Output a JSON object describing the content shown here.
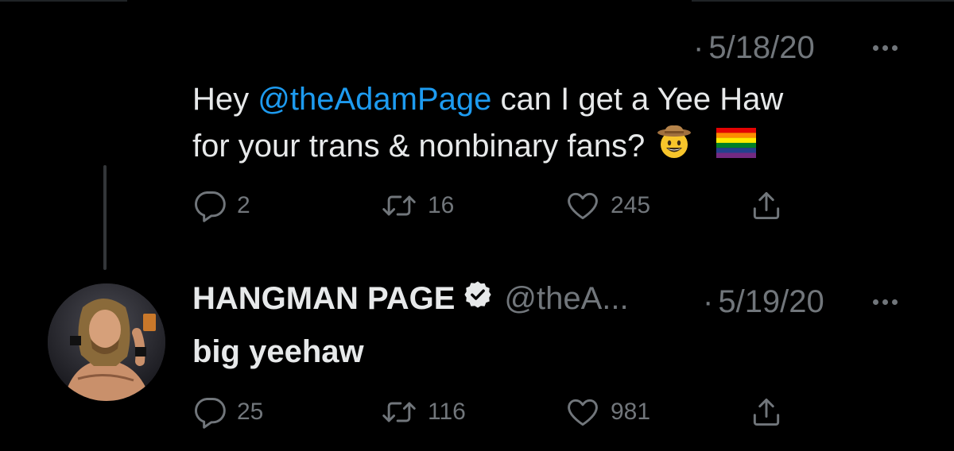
{
  "tweet1": {
    "timestamp": "5/18/20",
    "text_before": "Hey ",
    "mention": "@theAdamPage",
    "text_after_line1": " can I get a Yee Haw",
    "text_line2": "for your trans & nonbinary fans?",
    "emojis": [
      "cowboy-hat-face-emoji",
      "rainbow-flag-emoji"
    ],
    "replies": "2",
    "retweets": "16",
    "likes": "245"
  },
  "tweet2": {
    "author_name": "HANGMAN PAGE",
    "author_handle": "@theA...",
    "verified": true,
    "timestamp": "5/19/20",
    "text": "big yeehaw",
    "replies": "25",
    "retweets": "116",
    "likes": "981"
  },
  "colors": {
    "background": "#000000",
    "text": "#e7e9ea",
    "muted": "#71767b",
    "link": "#1d9bf0",
    "emoji_yellow": "#f7c52b",
    "hat_brown": "#a0703e"
  },
  "icons": [
    "reply-icon",
    "retweet-icon",
    "like-icon",
    "share-icon",
    "more-icon",
    "verified-badge-icon"
  ]
}
